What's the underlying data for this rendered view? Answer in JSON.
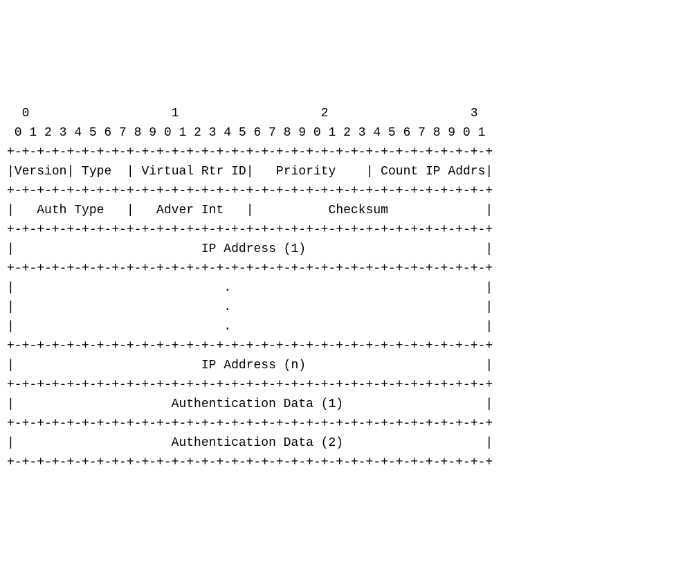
{
  "ruler": {
    "tens": "  0                   1                   2                   3",
    "units": " 0 1 2 3 4 5 6 7 8 9 0 1 2 3 4 5 6 7 8 9 0 1 2 3 4 5 6 7 8 9 0 1"
  },
  "sep32": "+-+-+-+-+-+-+-+-+-+-+-+-+-+-+-+-+-+-+-+-+-+-+-+-+-+-+-+-+-+-+-+-+",
  "rows": {
    "version": "Version",
    "type": " Type  ",
    "virtual_rtr_id": " Virtual Rtr ID",
    "priority": "   Priority    ",
    "count_ip_addrs": " Count IP Addrs",
    "auth_type": "   Auth Type   ",
    "adver_int": "   Adver Int   ",
    "checksum": "          Checksum             ",
    "ip_addr_1": "                         IP Address (1)                        ",
    "dots1": "                            .                                  ",
    "dots2": "                            .                                  ",
    "dots3": "                            .                                  ",
    "ip_addr_n": "                         IP Address (n)                        ",
    "auth_data_1": "                     Authentication Data (1)                   ",
    "auth_data_2": "                     Authentication Data (2)                   "
  },
  "bit_layout": [
    {
      "name": "Version",
      "bits": 4
    },
    {
      "name": "Type",
      "bits": 4
    },
    {
      "name": "Virtual Rtr ID",
      "bits": 8
    },
    {
      "name": "Priority",
      "bits": 8
    },
    {
      "name": "Count IP Addrs",
      "bits": 8
    },
    {
      "name": "Auth Type",
      "bits": 8
    },
    {
      "name": "Adver Int",
      "bits": 8
    },
    {
      "name": "Checksum",
      "bits": 16
    },
    {
      "name": "IP Address (1)",
      "bits": 32
    },
    {
      "name": "...",
      "bits": 32
    },
    {
      "name": "IP Address (n)",
      "bits": 32
    },
    {
      "name": "Authentication Data (1)",
      "bits": 32
    },
    {
      "name": "Authentication Data (2)",
      "bits": 32
    }
  ]
}
